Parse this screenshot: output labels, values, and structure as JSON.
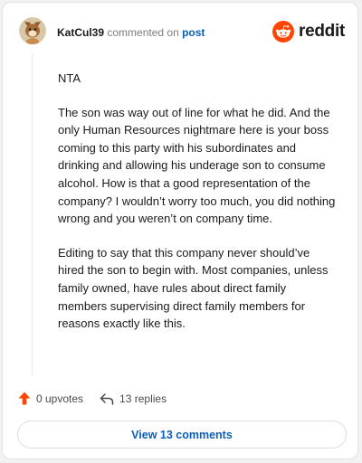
{
  "comment": {
    "username": "KatCul39",
    "action_text": "commented on",
    "post_link": "post",
    "body": [
      "NTA",
      "The son was way out of line for what he did. And the only Human Resources nightmare here is your boss coming to this party with his subordinates and drinking and allowing his underage son to consume alcohol. How is that a good representation of the company? I wouldn’t worry too much, you did nothing wrong and you weren’t on company time.",
      "Editing to say that this company never should’ve hired the son to begin with. Most companies, unless family owned, have rules about direct family members supervising direct family members for reasons exactly like this."
    ]
  },
  "brand": {
    "name": "reddit",
    "icon": "reddit-logo-icon",
    "color": "#ff4500"
  },
  "actions": {
    "upvotes": "0 upvotes",
    "replies": "13 replies",
    "upvote_icon": "upvote-arrow-icon",
    "reply_icon": "reply-arrow-icon",
    "upvote_color": "#ff4500"
  },
  "view_button": {
    "label": "View 13 comments"
  },
  "colors": {
    "link": "#0a5fb8",
    "text": "#1a1a1b",
    "muted": "#7c7c7c"
  }
}
